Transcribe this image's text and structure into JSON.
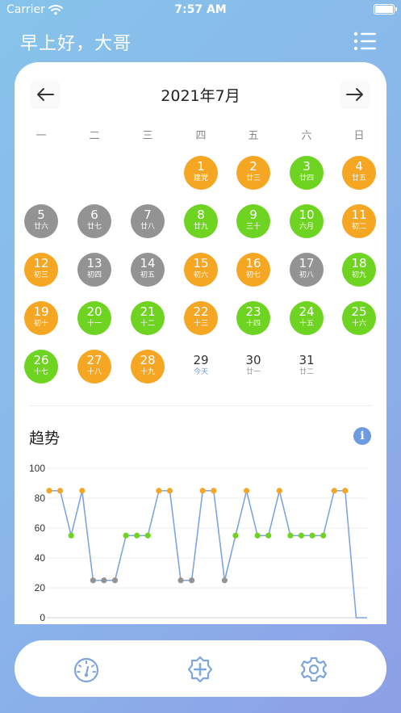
{
  "status_bar": {
    "carrier": "Carrier",
    "time": "7:57 AM"
  },
  "header": {
    "greeting": "早上好，大哥"
  },
  "calendar": {
    "month_title": "2021年7月",
    "weekdays": [
      "一",
      "二",
      "三",
      "四",
      "五",
      "六",
      "日"
    ],
    "days": [
      {
        "num": "1",
        "lunar": "建党",
        "status": "orange"
      },
      {
        "num": "2",
        "lunar": "廿三",
        "status": "orange"
      },
      {
        "num": "3",
        "lunar": "廿四",
        "status": "green"
      },
      {
        "num": "4",
        "lunar": "廿五",
        "status": "orange"
      },
      {
        "num": "5",
        "lunar": "廿六",
        "status": "gray"
      },
      {
        "num": "6",
        "lunar": "廿七",
        "status": "gray"
      },
      {
        "num": "7",
        "lunar": "廿八",
        "status": "gray"
      },
      {
        "num": "8",
        "lunar": "廿九",
        "status": "green"
      },
      {
        "num": "9",
        "lunar": "三十",
        "status": "green"
      },
      {
        "num": "10",
        "lunar": "六月",
        "status": "green"
      },
      {
        "num": "11",
        "lunar": "初二",
        "status": "orange"
      },
      {
        "num": "12",
        "lunar": "初三",
        "status": "orange"
      },
      {
        "num": "13",
        "lunar": "初四",
        "status": "gray"
      },
      {
        "num": "14",
        "lunar": "初五",
        "status": "gray"
      },
      {
        "num": "15",
        "lunar": "初六",
        "status": "orange"
      },
      {
        "num": "16",
        "lunar": "初七",
        "status": "orange"
      },
      {
        "num": "17",
        "lunar": "初八",
        "status": "gray"
      },
      {
        "num": "18",
        "lunar": "初九",
        "status": "green"
      },
      {
        "num": "19",
        "lunar": "初十",
        "status": "orange"
      },
      {
        "num": "20",
        "lunar": "十一",
        "status": "green"
      },
      {
        "num": "21",
        "lunar": "十二",
        "status": "green"
      },
      {
        "num": "22",
        "lunar": "十三",
        "status": "orange"
      },
      {
        "num": "23",
        "lunar": "十四",
        "status": "green"
      },
      {
        "num": "24",
        "lunar": "十五",
        "status": "green"
      },
      {
        "num": "25",
        "lunar": "十六",
        "status": "green"
      },
      {
        "num": "26",
        "lunar": "十七",
        "status": "green"
      },
      {
        "num": "27",
        "lunar": "十八",
        "status": "orange"
      },
      {
        "num": "28",
        "lunar": "十九",
        "status": "orange"
      },
      {
        "num": "29",
        "lunar": "今天",
        "status": "none",
        "today": true
      },
      {
        "num": "30",
        "lunar": "廿一",
        "status": "none"
      },
      {
        "num": "31",
        "lunar": "廿二",
        "status": "none"
      }
    ]
  },
  "trend": {
    "title": "趋势"
  },
  "colors": {
    "orange": "#f5a623",
    "green": "#6fd322",
    "gray": "#939393",
    "line": "#7fa6dc",
    "accent": "#6e9be0"
  },
  "icons": {
    "menu": "list-icon",
    "prev": "arrow-left-icon",
    "next": "arrow-right-icon",
    "info": "info-icon",
    "tab_dashboard": "gauge-icon",
    "tab_add": "add-badge-icon",
    "tab_settings": "gear-icon"
  },
  "chart_data": {
    "type": "line",
    "ylim": [
      0,
      100
    ],
    "yticks": [
      0,
      20,
      40,
      60,
      80,
      100
    ],
    "x": [
      1,
      2,
      3,
      4,
      5,
      6,
      7,
      8,
      9,
      10,
      11,
      12,
      13,
      14,
      15,
      16,
      17,
      18,
      19,
      20,
      21,
      22,
      23,
      24,
      25,
      26,
      27,
      28,
      29,
      30
    ],
    "values": [
      85,
      85,
      55,
      85,
      25,
      25,
      25,
      55,
      55,
      55,
      85,
      85,
      25,
      25,
      85,
      85,
      25,
      55,
      85,
      55,
      55,
      85,
      55,
      55,
      55,
      55,
      85,
      85,
      0,
      0
    ],
    "point_status": [
      "orange",
      "orange",
      "green",
      "orange",
      "gray",
      "gray",
      "gray",
      "green",
      "green",
      "green",
      "orange",
      "orange",
      "gray",
      "gray",
      "orange",
      "orange",
      "gray",
      "green",
      "orange",
      "green",
      "green",
      "orange",
      "green",
      "green",
      "green",
      "green",
      "orange",
      "orange",
      "none",
      "none"
    ]
  }
}
